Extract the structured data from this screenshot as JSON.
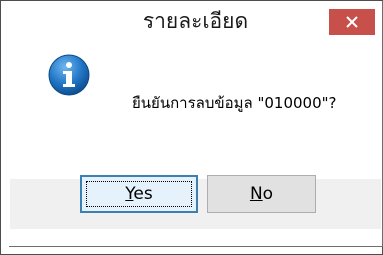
{
  "dialog": {
    "title": "รายละเอียด",
    "message": "ยืนยันการลบข้อมูล \"010000\"?",
    "icon": "info-icon",
    "close_icon": "close-icon"
  },
  "buttons": {
    "yes": {
      "accel": "Y",
      "rest": "es"
    },
    "no": {
      "accel": "N",
      "rest": "o"
    }
  },
  "colors": {
    "close_bg": "#c7504b",
    "info_blue": "#1f6fb5",
    "default_border": "#3c7fb1"
  }
}
